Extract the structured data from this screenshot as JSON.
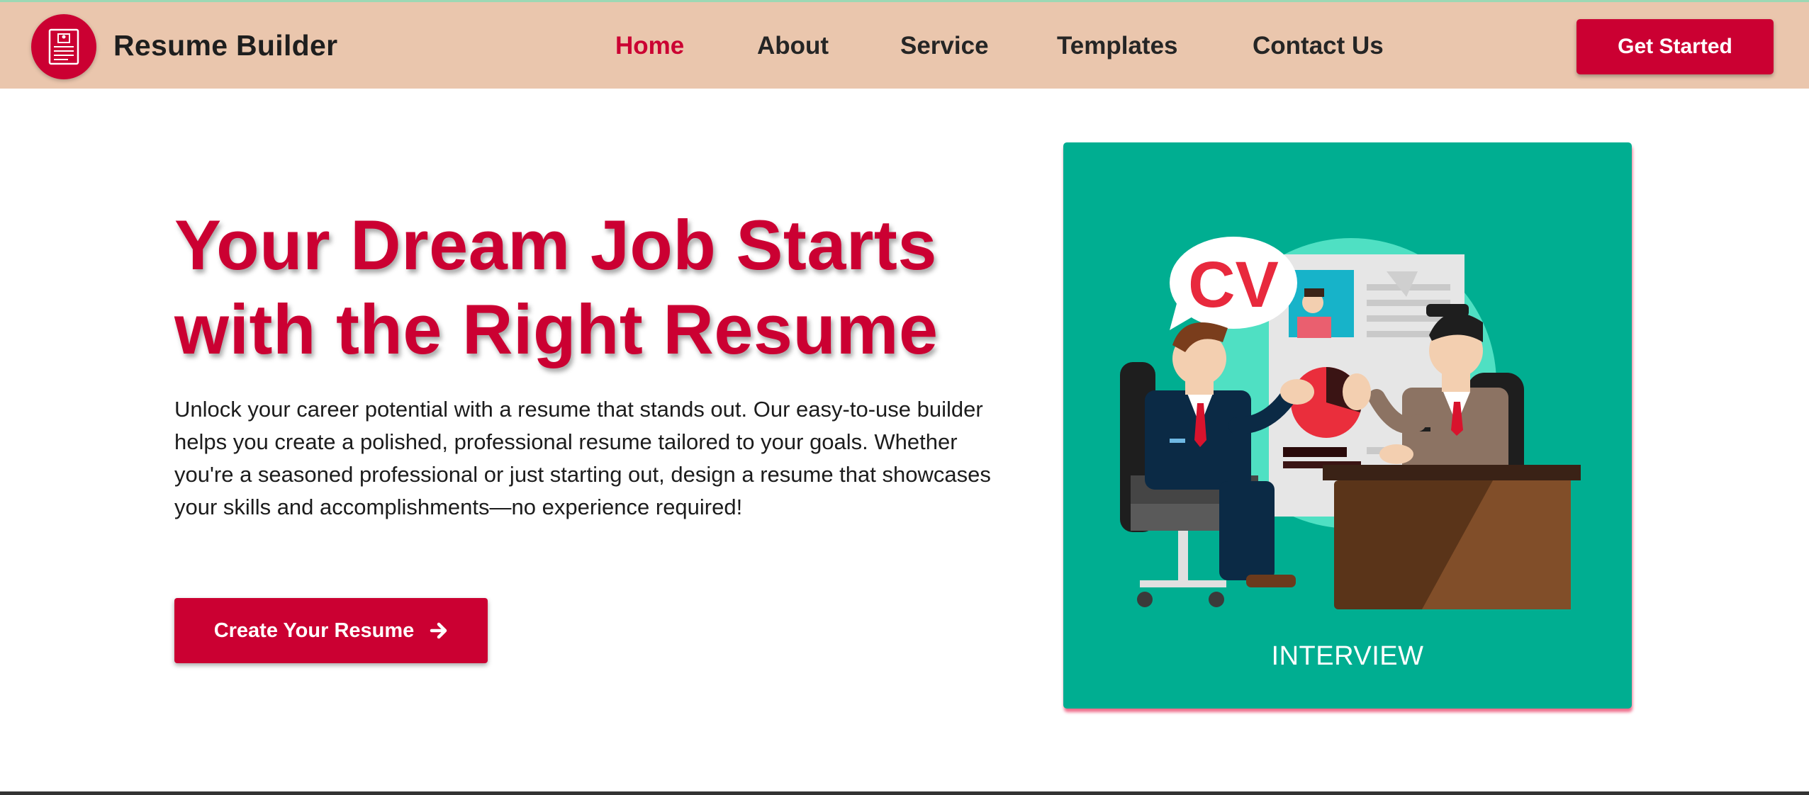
{
  "header": {
    "brand": "Resume Builder",
    "nav": [
      {
        "label": "Home",
        "active": true
      },
      {
        "label": "About",
        "active": false
      },
      {
        "label": "Service",
        "active": false
      },
      {
        "label": "Templates",
        "active": false
      },
      {
        "label": "Contact Us",
        "active": false
      }
    ],
    "cta_label": "Get Started",
    "logo_icon": "resume-document-icon"
  },
  "hero": {
    "title": "Your Dream Job Starts with the Right Resume",
    "description": "Unlock your career potential with a resume that stands out. Our easy-to-use builder helps you create a polished, professional resume tailored to your goals. Whether you're a seasoned professional or just starting out, design a resume that showcases your skills and accomplishments—no experience required!",
    "cta_label": "Create Your Resume",
    "cta_icon": "arrow-right-icon"
  },
  "illustration": {
    "speech_bubble_text": "CV",
    "caption": "INTERVIEW"
  },
  "colors": {
    "accent": "#cb0032",
    "nav_background": "#eac6ad",
    "card_background": "#00ae91"
  }
}
